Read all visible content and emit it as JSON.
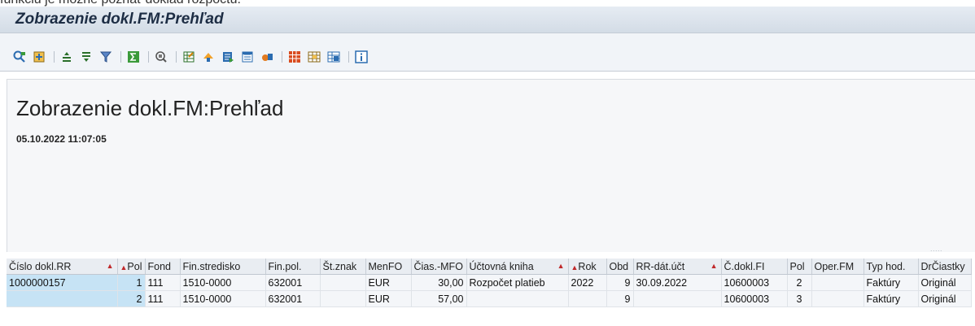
{
  "clip_text": "funkciu je možné poznať doklad rozpočtu.",
  "window": {
    "title": "Zobrazenie dokl.FM:Prehľad"
  },
  "toolbar": {
    "buttons": [
      {
        "name": "details-icon"
      },
      {
        "name": "select-layout-icon"
      },
      {
        "sep": true
      },
      {
        "name": "sort-ascending-icon"
      },
      {
        "name": "sort-descending-icon"
      },
      {
        "name": "filter-icon"
      },
      {
        "sep": true
      },
      {
        "name": "total-icon"
      },
      {
        "sep": true
      },
      {
        "name": "print-preview-icon"
      },
      {
        "sep": true
      },
      {
        "name": "export-spreadsheet-icon"
      },
      {
        "name": "local-file-icon"
      },
      {
        "name": "word-processing-icon"
      },
      {
        "name": "abc-analysis-icon"
      },
      {
        "name": "graphic-icon"
      },
      {
        "sep": true
      },
      {
        "name": "change-layout-icon"
      },
      {
        "name": "choose-layout-icon"
      },
      {
        "name": "save-layout-icon"
      },
      {
        "sep": true
      },
      {
        "name": "info-icon"
      }
    ]
  },
  "header": {
    "title": "Zobrazenie dokl.FM:Prehľad",
    "timestamp": "05.10.2022 11:07:05"
  },
  "splitter_grip": ".....",
  "table": {
    "columns": [
      {
        "label": "Číslo dokl.RR",
        "sort": "right"
      },
      {
        "label": "Pol",
        "sort": "left"
      },
      {
        "label": "Fond"
      },
      {
        "label": "Fin.stredisko"
      },
      {
        "label": "Fin.pol."
      },
      {
        "label": "Št.znak"
      },
      {
        "label": "MenFO"
      },
      {
        "label": "Čias.-MFO"
      },
      {
        "label": "Účtovná kniha",
        "sort": "right"
      },
      {
        "label": "Rok",
        "sort": "left"
      },
      {
        "label": "Obd"
      },
      {
        "label": "RR-dát.účt",
        "sort": "right"
      },
      {
        "label": "Č.dokl.FI"
      },
      {
        "label": "Pol"
      },
      {
        "label": "Oper.FM"
      },
      {
        "label": "Typ hod."
      },
      {
        "label": "DrČiastky"
      }
    ],
    "rows": [
      [
        "1000000157",
        "1",
        "111",
        "1510-0000",
        "632001",
        "",
        "EUR",
        "30,00",
        "Rozpočet platieb",
        "2022",
        "9",
        "30.09.2022",
        "10600003",
        "2",
        "",
        "Faktúry",
        "Originál"
      ],
      [
        "",
        "2",
        "111",
        "1510-0000",
        "632001",
        "",
        "EUR",
        "57,00",
        "",
        "",
        "9",
        "",
        "10600003",
        "3",
        "",
        "Faktúry",
        "Originál"
      ]
    ]
  },
  "colors": {
    "key_cell": "#c6e3f5",
    "sort_arrow": "#c0292b",
    "title_text": "#1d2d44"
  }
}
